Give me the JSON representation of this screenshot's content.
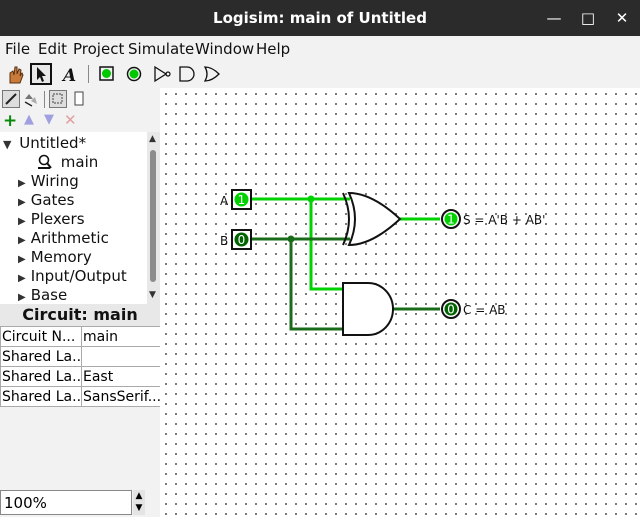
{
  "window": {
    "title": "Logisim: main of Untitled",
    "controls": [
      "✕",
      "□",
      "—"
    ]
  },
  "menu": [
    "File",
    "Edit",
    "Project",
    "Simulate",
    "Window",
    "Help"
  ],
  "explorer": {
    "project": "Untitled*",
    "circuit": "main",
    "libraries": [
      "Wiring",
      "Gates",
      "Plexers",
      "Arithmetic",
      "Memory",
      "Input/Output",
      "Base"
    ]
  },
  "attributes": {
    "title": "Circuit: main",
    "rows": [
      {
        "name": "Circuit N...",
        "value": "main"
      },
      {
        "name": "Shared La...",
        "value": ""
      },
      {
        "name": "Shared La...",
        "value": "East"
      },
      {
        "name": "Shared La...",
        "value": "SansSerif..."
      }
    ]
  },
  "zoom": "100%",
  "circuit": {
    "inputs": [
      {
        "label": "A",
        "value": "1"
      },
      {
        "label": "B",
        "value": "0"
      }
    ],
    "outputs": [
      {
        "label": "S = A'B + AB'",
        "value": "1"
      },
      {
        "label": "C = AB",
        "value": "0"
      }
    ],
    "colors": {
      "high": "#00d200",
      "low": "#006400",
      "wire_dark": "#1a6b1a"
    }
  }
}
